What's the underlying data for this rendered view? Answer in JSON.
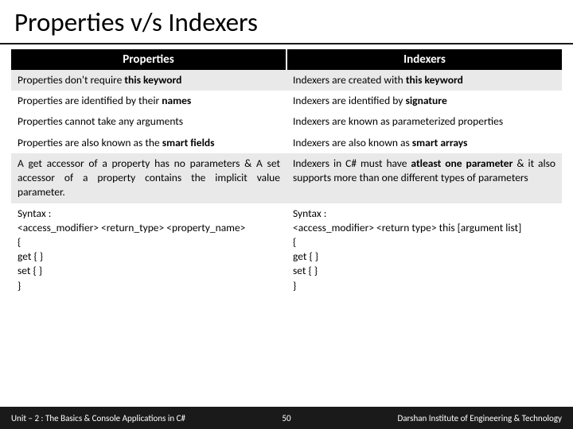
{
  "title": "Properties v/s Indexers",
  "headers": {
    "left": "Properties",
    "right": "Indexers"
  },
  "rows": {
    "r1l": "Properties don't require <span class='bold'>this keyword</span>",
    "r1r": "Indexers are created with <span class='bold'>this keyword</span>",
    "r2l": "Properties are identified by their <span class='bold'>names</span>",
    "r2r": "Indexers are identified by <span class='bold'>signature</span>",
    "r3l": "Properties cannot take any arguments",
    "r3r": "Indexers are known as parameterized properties",
    "r4l": "Properties are also known as the <span class='bold'>smart fields</span>",
    "r4r": "Indexers are also known as <span class='bold'>smart arrays</span>",
    "r5l": "A get accessor of a property has no parameters &amp; A set accessor of a property contains the implicit value parameter.",
    "r5r": "Indexers in C# must have <span class='bold'>atleast one parameter</span> &amp; it also supports more than one different types of parameters",
    "r6l": "Syntax :<br>&lt;access_modifier&gt; &lt;return_type&gt; &lt;property_name&gt;<br>{<br>get { }<br>set { }<br>}",
    "r6r": "Syntax :<br>&lt;access_modifier&gt; &lt;return type&gt; this [argument list]<br>{<br>get { }<br>set { }<br>}"
  },
  "footer": {
    "left": "Unit – 2 : The Basics & Console Applications in C#",
    "page": "50",
    "right": "Darshan Institute of Engineering & Technology"
  }
}
